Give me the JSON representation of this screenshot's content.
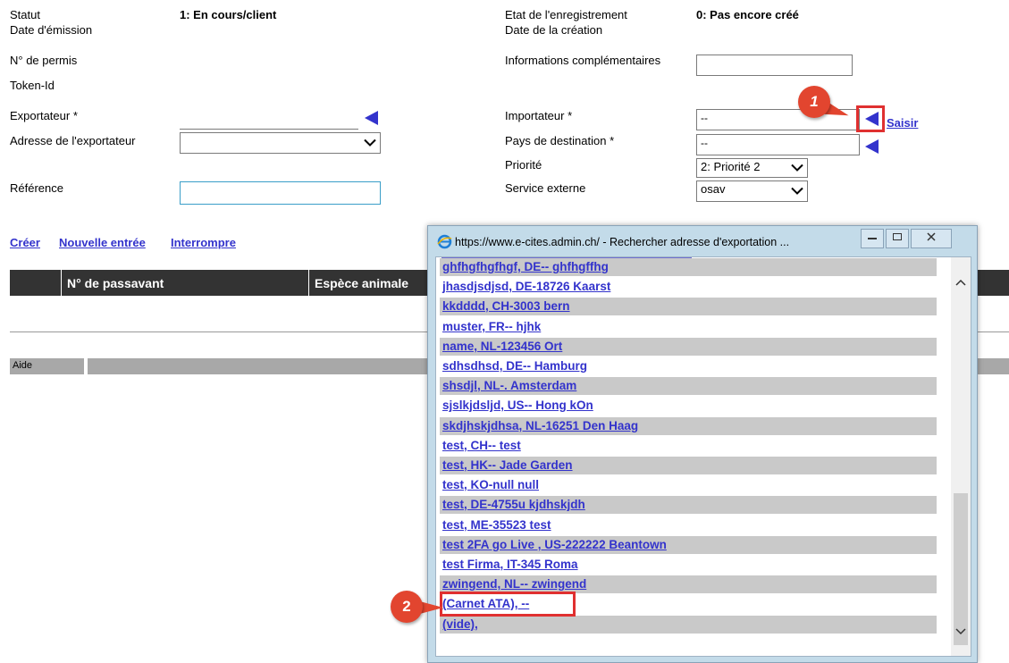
{
  "form": {
    "statut_label": "Statut",
    "statut_value": "1: En cours/client",
    "date_emission_label": "Date d'émission",
    "etat_label": "Etat de l'enregistrement",
    "etat_value": "0: Pas encore créé",
    "date_creation_label": "Date de la création",
    "permis_label": "N° de permis",
    "infos_label": "Informations complémentaires",
    "token_label": "Token-Id",
    "exportateur_label": "Exportateur *",
    "importateur_label": "Importateur *",
    "importateur_value": "--",
    "saisir_link": "Saisir",
    "adresse_exp_label": "Adresse de l'exportateur",
    "pays_label": "Pays de destination *",
    "pays_value": "--",
    "priorite_label": "Priorité",
    "priorite_value": "2: Priorité 2",
    "reference_label": "Référence",
    "service_label": "Service externe",
    "service_value": "osav"
  },
  "actions": {
    "creer": "Créer",
    "nouvelle": "Nouvelle entrée",
    "interrompre": "Interrompre"
  },
  "table": {
    "col_passavant": "N° de passavant",
    "col_espece": "Espèce animale"
  },
  "aide_label": "Aide",
  "callouts": {
    "one": "1",
    "two": "2"
  },
  "popup": {
    "title": "https://www.e-cites.admin.ch/ - Rechercher adresse d'exportation ...",
    "items": [
      "ghfhgfhgfhgf, DE-- ghfhgffhg",
      "jhasdjsdjsd, DE-18726 Kaarst",
      "kkdddd, CH-3003 bern",
      "muster, FR-- hjhk",
      "name, NL-123456 Ort",
      "sdhsdhsd, DE-- Hamburg",
      "shsdjl, NL-. Amsterdam",
      "sjslkjdsljd, US-- Hong kOn",
      "skdjhskjdhsa, NL-16251 Den Haag",
      "test, CH-- test",
      "test, HK-- Jade Garden",
      "test, KO-null null",
      "test, DE-4755u kjdhskjdh",
      "test, ME-35523 test",
      "test 2FA go Live , US-222222 Beantown",
      "test Firma, IT-345 Roma",
      "zwingend, NL-- zwingend",
      "(Carnet ATA), --",
      "(vide),"
    ]
  },
  "colors": {
    "link": "#3333cc",
    "callout": "#e2452f",
    "highlight": "#e03030"
  }
}
